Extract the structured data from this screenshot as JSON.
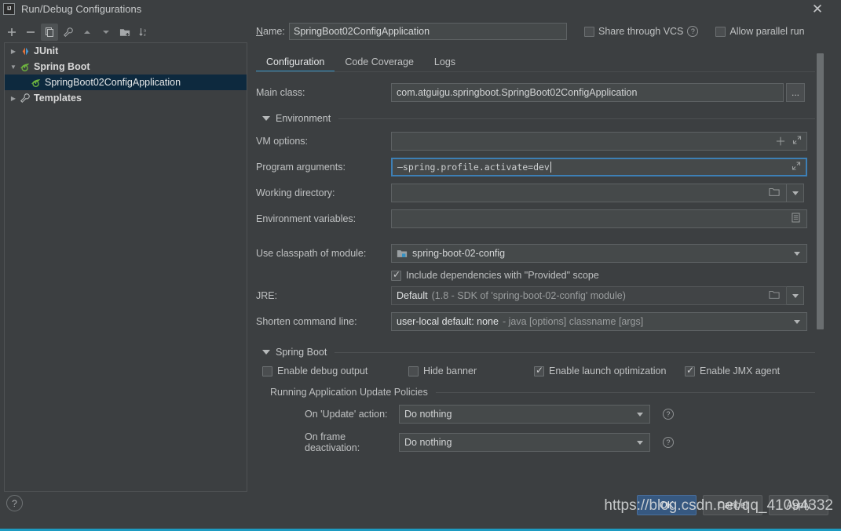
{
  "window": {
    "title": "Run/Debug Configurations",
    "app_icon": "IJ",
    "close_icon": "close-icon"
  },
  "toolbar": {
    "buttons": [
      {
        "name": "add-configuration-button",
        "icon": "plus-icon",
        "selected": false
      },
      {
        "name": "remove-configuration-button",
        "icon": "minus-icon",
        "selected": false
      },
      {
        "name": "copy-configuration-button",
        "icon": "copy-icon",
        "selected": true
      },
      {
        "name": "edit-templates-button",
        "icon": "wrench-icon",
        "selected": false
      },
      {
        "name": "move-up-button",
        "icon": "arrow-up-icon",
        "selected": false
      },
      {
        "name": "move-down-button",
        "icon": "arrow-down-icon",
        "selected": false
      },
      {
        "name": "new-folder-button",
        "icon": "folder-add-icon",
        "selected": false
      },
      {
        "name": "sort-alphabetically-button",
        "icon": "sort-az-icon",
        "selected": false
      }
    ]
  },
  "tree": {
    "items": [
      {
        "label": "JUnit",
        "icon": "junit-icon",
        "expanded": false,
        "level": 0,
        "selected": false
      },
      {
        "label": "Spring Boot",
        "icon": "spring-boot-icon",
        "expanded": true,
        "level": 0,
        "selected": false
      },
      {
        "label": "SpringBoot02ConfigApplication",
        "icon": "spring-boot-icon",
        "level": 1,
        "selected": true
      },
      {
        "label": "Templates",
        "icon": "wrench-icon",
        "expanded": false,
        "level": 0,
        "selected": false
      }
    ]
  },
  "header": {
    "name_label": "Name:",
    "name_value": "SpringBoot02ConfigApplication",
    "share_vcs_label": "Share through VCS",
    "share_vcs_checked": false,
    "share_vcs_help": "?",
    "allow_parallel_label": "Allow parallel run",
    "allow_parallel_checked": false
  },
  "tabs": [
    {
      "label": "Configuration",
      "active": true
    },
    {
      "label": "Code Coverage",
      "active": false
    },
    {
      "label": "Logs",
      "active": false
    }
  ],
  "configuration": {
    "main_class_label": "Main class:",
    "main_class_value": "com.atguigu.springboot.SpringBoot02ConfigApplication",
    "main_class_browse": "...",
    "environment_section": "Environment",
    "vm_options_label": "VM options:",
    "vm_options_value": "",
    "program_arguments_label": "Program arguments:",
    "program_arguments_value": "—spring.profile.activate=dev",
    "working_directory_label": "Working directory:",
    "working_directory_value": "",
    "environment_variables_label": "Environment variables:",
    "environment_variables_value": "",
    "use_classpath_label": "Use classpath of module:",
    "use_classpath_value": "spring-boot-02-config",
    "include_provided_label": "Include dependencies with \"Provided\" scope",
    "include_provided_checked": true,
    "jre_label": "JRE:",
    "jre_value": "Default",
    "jre_hint": "(1.8 - SDK of 'spring-boot-02-config' module)",
    "shorten_command_label": "Shorten command line:",
    "shorten_command_value": "user-local default: none",
    "shorten_command_hint": "- java [options] classname [args]"
  },
  "spring_boot": {
    "section_title": "Spring Boot",
    "checkboxes": [
      {
        "label": "Enable debug output",
        "checked": false,
        "name": "enable-debug-output-checkbox"
      },
      {
        "label": "Hide banner",
        "checked": false,
        "name": "hide-banner-checkbox"
      },
      {
        "label": "Enable launch optimization",
        "checked": true,
        "name": "enable-launch-optimization-checkbox"
      },
      {
        "label": "Enable JMX agent",
        "checked": true,
        "name": "enable-jmx-agent-checkbox"
      }
    ],
    "policies_title": "Running Application Update Policies",
    "policies": [
      {
        "label": "On 'Update' action:",
        "value": "Do nothing",
        "help": "?",
        "name": "on-update-action"
      },
      {
        "label": "On frame deactivation:",
        "value": "Do nothing",
        "help": "?",
        "name": "on-frame-deactivation"
      }
    ]
  },
  "footer": {
    "help_icon": "?",
    "ok_label": "OK",
    "cancel_label": "Cancel",
    "apply_label": "Apply"
  },
  "watermark": {
    "text": "https://blog.csdn.net/qq_41094332"
  },
  "colors": {
    "background": "#3c3f41",
    "field_background": "#45494a",
    "accent": "#3592c4",
    "selection": "#0d293e",
    "default_button": "#365880",
    "bottom_border": "#1d9bc1"
  }
}
